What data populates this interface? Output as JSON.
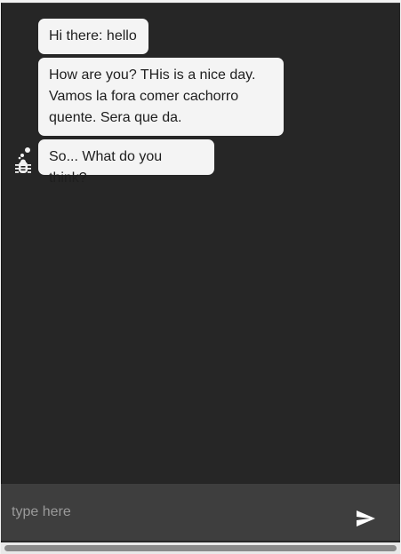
{
  "messages": [
    {
      "text": "Hi there: hello"
    },
    {
      "text": "How are you? THis is a nice day. Vamos la fora comer cachorro quente. Sera que da."
    },
    {
      "text": "So... What do you think?"
    }
  ],
  "composer": {
    "placeholder": "type here",
    "value": ""
  },
  "icons": {
    "bot_avatar": "bug-icon",
    "typing": "thinking-dots-icon",
    "send": "send-icon"
  },
  "colors": {
    "chat_background": "#262626",
    "bubble_background": "#f4f4f4",
    "composer_background": "#3e3e3e"
  }
}
